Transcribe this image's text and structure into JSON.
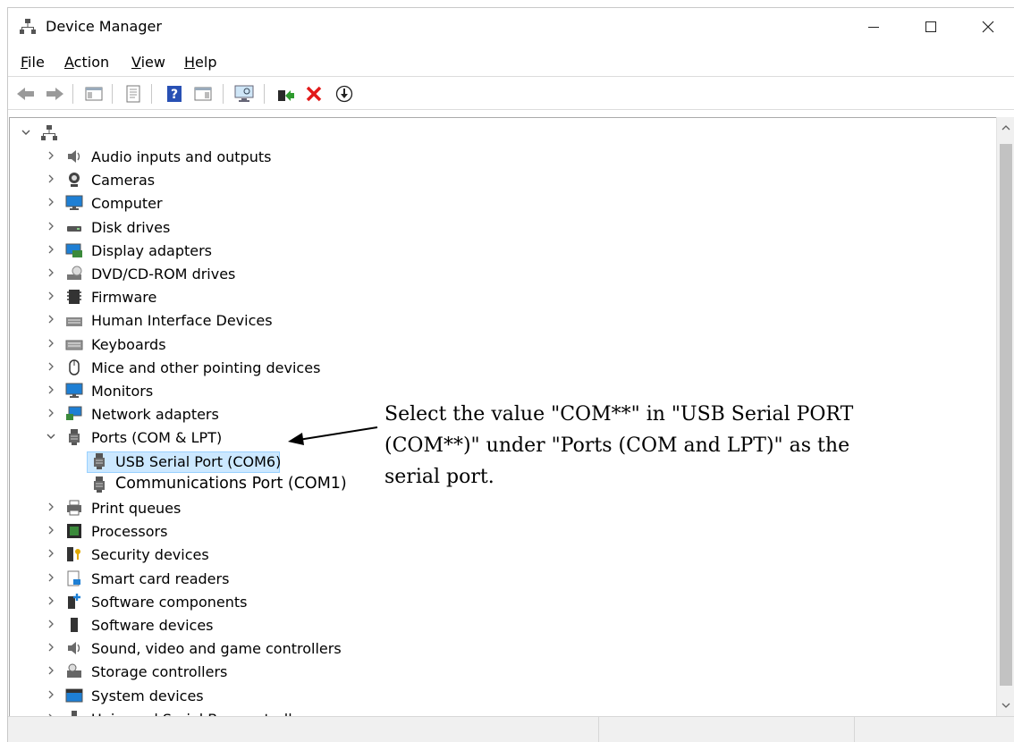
{
  "window": {
    "title": "Device Manager"
  },
  "menu": [
    {
      "key": "F",
      "rest": "ile"
    },
    {
      "key": "A",
      "rest": "ction"
    },
    {
      "key": "V",
      "rest": "iew"
    },
    {
      "key": "H",
      "rest": "elp"
    }
  ],
  "toolbar_icons": [
    "back-icon",
    "forward-icon",
    "show-hide-console-tree-icon",
    "properties-icon",
    "help-icon",
    "show-action-pane-icon",
    "scan-hardware-icon",
    "update-driver-icon",
    "uninstall-device-icon",
    "disable-device-icon"
  ],
  "tree": {
    "root_icon": "computer-network-icon",
    "categories": [
      {
        "label": "Audio inputs and outputs",
        "icon": "speaker-icon"
      },
      {
        "label": "Cameras",
        "icon": "camera-icon"
      },
      {
        "label": "Computer",
        "icon": "monitor-icon"
      },
      {
        "label": "Disk drives",
        "icon": "disk-drive-icon"
      },
      {
        "label": "Display adapters",
        "icon": "display-adapter-icon"
      },
      {
        "label": "DVD/CD-ROM drives",
        "icon": "dvd-drive-icon"
      },
      {
        "label": "Firmware",
        "icon": "firmware-icon"
      },
      {
        "label": "Human Interface Devices",
        "icon": "hid-icon"
      },
      {
        "label": "Keyboards",
        "icon": "keyboard-icon"
      },
      {
        "label": "Mice and other pointing devices",
        "icon": "mouse-icon"
      },
      {
        "label": "Monitors",
        "icon": "monitor-icon"
      },
      {
        "label": "Network adapters",
        "icon": "network-adapter-icon"
      },
      {
        "label": "Ports (COM & LPT)",
        "icon": "port-icon",
        "expanded": true
      },
      {
        "label": "Print queues",
        "icon": "printer-icon"
      },
      {
        "label": "Processors",
        "icon": "processor-icon"
      },
      {
        "label": "Security devices",
        "icon": "security-device-icon"
      },
      {
        "label": "Smart card readers",
        "icon": "smart-card-icon"
      },
      {
        "label": "Software components",
        "icon": "software-component-icon"
      },
      {
        "label": "Software devices",
        "icon": "software-device-icon"
      },
      {
        "label": "Sound, video and game controllers",
        "icon": "speaker-icon"
      },
      {
        "label": "Storage controllers",
        "icon": "storage-controller-icon"
      },
      {
        "label": "System devices",
        "icon": "system-devices-icon"
      },
      {
        "label": "Universal Serial Bus controllers",
        "icon": "usb-icon"
      }
    ],
    "ports_children": [
      {
        "label": "USB Serial Port (COM6)",
        "selected": true
      },
      {
        "label": "Communications Port (COM1)"
      }
    ]
  },
  "annotation": {
    "line1": "Select the value \"COM**\" in \"USB Serial PORT",
    "line2": "(COM**)\" under \"Ports (COM and LPT)\" as the",
    "line3": "serial port."
  },
  "colors": {
    "selection": "#cce8ff",
    "selection_border": "#99d1ff"
  }
}
